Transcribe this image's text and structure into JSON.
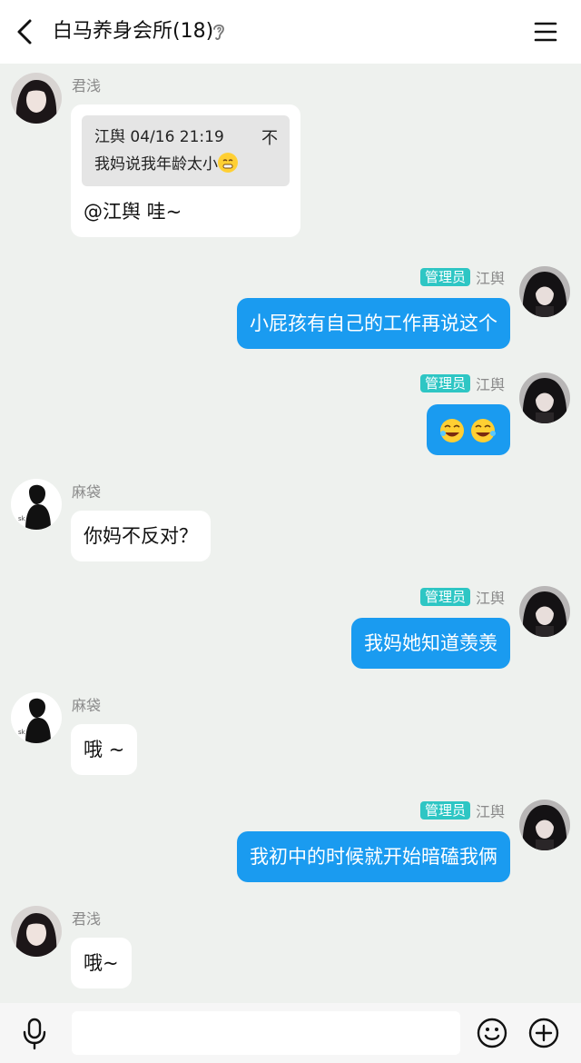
{
  "header": {
    "back_icon": "chevron-left-icon",
    "title": "白马养身会所(18)",
    "ear_icon": "ear-icon",
    "menu_icon": "hamburger-menu-icon"
  },
  "labels": {
    "admin_badge": "管理员"
  },
  "messages": [
    {
      "side": "left",
      "sender": "君浅",
      "quote": {
        "author_time": "江舆 04/16 21:19",
        "flag": "不",
        "text": "我妈说我年龄太小"
      },
      "text": "@江舆 哇~"
    },
    {
      "side": "right",
      "sender": "江舆",
      "text": "小屁孩有自己的工作再说这个"
    },
    {
      "side": "right",
      "sender": "江舆",
      "sticker": "two-laughing-emoji"
    },
    {
      "side": "left",
      "sender": "麻袋",
      "text": "你妈不反对？"
    },
    {
      "side": "right",
      "sender": "江舆",
      "text": "我妈她知道羡羡"
    },
    {
      "side": "left",
      "sender": "麻袋",
      "text": "哦 ~"
    },
    {
      "side": "right",
      "sender": "江舆",
      "text": "我初中的时候就开始暗磕我俩"
    },
    {
      "side": "left",
      "sender": "君浅",
      "text": "哦~"
    }
  ],
  "input_bar": {
    "mic_icon": "microphone-icon",
    "input_value": "",
    "emoji_icon": "smiley-icon",
    "add_icon": "plus-circle-icon"
  },
  "colors": {
    "outgoing_bubble": "#1a9bf0",
    "incoming_bubble": "#ffffff",
    "admin_badge": "#2ec6c4",
    "chat_background": "#eef1ee"
  }
}
